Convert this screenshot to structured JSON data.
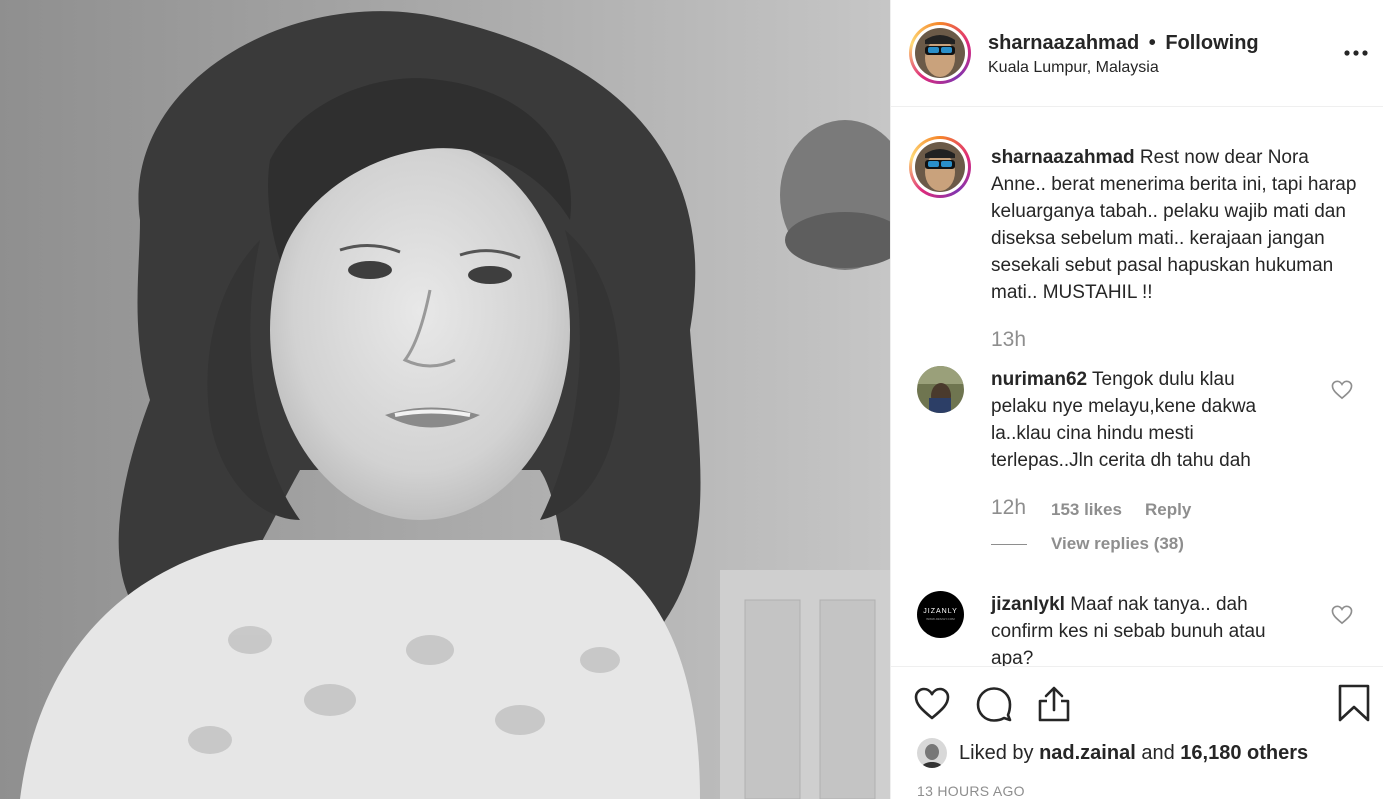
{
  "post": {
    "username": "sharnaazahmad",
    "separator": "•",
    "follow_status": "Following",
    "location": "Kuala Lumpur, Malaysia"
  },
  "caption": {
    "username": "sharnaazahmad",
    "text": "Rest now dear Nora Anne.. berat menerima berita ini, tapi harap keluarganya tabah.. pelaku wajib mati dan diseksa sebelum mati.. kerajaan jangan sesekali sebut pasal hapuskan hukuman mati.. MUSTAHIL !!",
    "time": "13h"
  },
  "comments": [
    {
      "username": "nuriman62",
      "text": "Tengok dulu klau pelaku nye melayu,kene dakwa la..klau cina hindu mesti terlepas..Jln cerita dh tahu dah",
      "time": "12h",
      "likes": "153 likes",
      "reply": "Reply",
      "view_replies": "View replies (38)"
    },
    {
      "username": "jizanlykl",
      "text": "Maaf nak tanya.. dah confirm kes ni sebab bunuh atau apa?",
      "avatar_text": "JIZANLY",
      "avatar_subtext": "WWW.JIZANLY.COM"
    }
  ],
  "likes": {
    "prefix": "Liked by",
    "user": "nad.zainal",
    "connector": "and",
    "others": "16,180 others"
  },
  "timestamp": "13 HOURS AGO",
  "icons": {
    "more": "more-options-icon",
    "like": "heart-icon",
    "comment": "comment-icon",
    "share": "share-icon",
    "save": "bookmark-icon"
  },
  "colors": {
    "text": "#262626",
    "muted": "#8e8e8e",
    "divider": "#efefef"
  }
}
